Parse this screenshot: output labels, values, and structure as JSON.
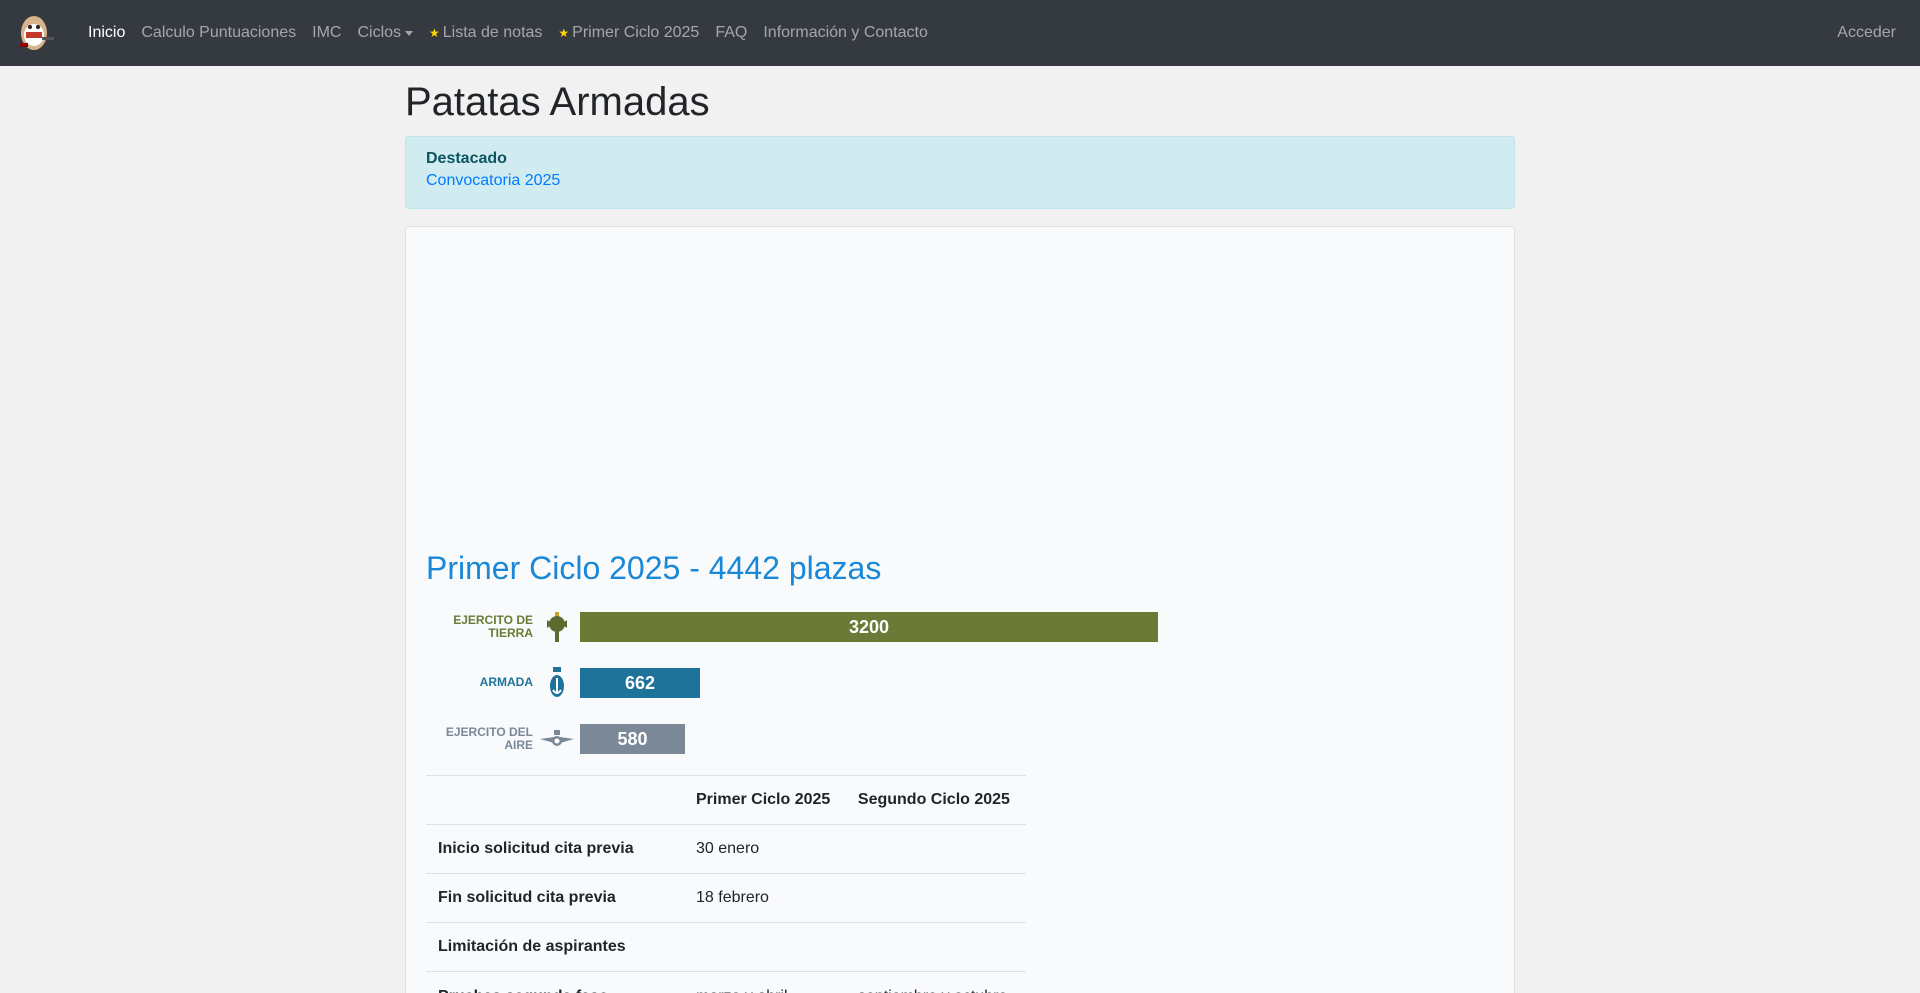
{
  "nav": {
    "items": [
      {
        "label": "Inicio",
        "active": true,
        "star": false,
        "dropdown": false
      },
      {
        "label": "Calculo Puntuaciones",
        "active": false,
        "star": false,
        "dropdown": false
      },
      {
        "label": "IMC",
        "active": false,
        "star": false,
        "dropdown": false
      },
      {
        "label": "Ciclos",
        "active": false,
        "star": false,
        "dropdown": true
      },
      {
        "label": "Lista de notas",
        "active": false,
        "star": true,
        "dropdown": false
      },
      {
        "label": "Primer Ciclo 2025",
        "active": false,
        "star": true,
        "dropdown": false
      },
      {
        "label": "FAQ",
        "active": false,
        "star": false,
        "dropdown": false
      },
      {
        "label": "Información y Contacto",
        "active": false,
        "star": false,
        "dropdown": false
      }
    ],
    "login": "Acceder"
  },
  "page": {
    "title": "Patatas Armadas"
  },
  "alert": {
    "title": "Destacado",
    "link": "Convocatoria 2025"
  },
  "section": {
    "title": "Primer Ciclo 2025 - 4442 plazas"
  },
  "chart_data": {
    "type": "bar",
    "orientation": "horizontal",
    "categories": [
      "EJERCITO DE TIERRA",
      "ARMADA",
      "EJERCITO DEL AIRE"
    ],
    "values": [
      3200,
      662,
      580
    ],
    "colors": [
      "#6b7a37",
      "#1f739a",
      "#7b8898"
    ],
    "label_colors": [
      "#6b7a37",
      "#1f739a",
      "#7b8898"
    ],
    "icons": [
      "army-crest-icon",
      "navy-crest-icon",
      "airforce-crest-icon"
    ]
  },
  "table": {
    "headers": [
      "",
      "Primer Ciclo 2025",
      "Segundo Ciclo 2025"
    ],
    "rows": [
      [
        "Inicio solicitud cita previa",
        "30 enero",
        ""
      ],
      [
        "Fin solicitud cita previa",
        "18 febrero",
        ""
      ],
      [
        "Limitación de aspirantes",
        "",
        ""
      ],
      [
        "Pruebas segunda fase",
        "marzo y abril",
        "septiembre y octubre"
      ]
    ]
  }
}
